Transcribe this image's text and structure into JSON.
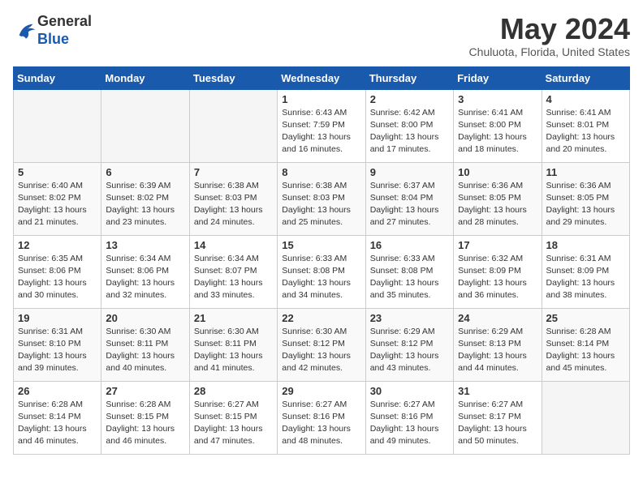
{
  "logo": {
    "general": "General",
    "blue": "Blue"
  },
  "title": {
    "month_year": "May 2024",
    "location": "Chuluota, Florida, United States"
  },
  "days_of_week": [
    "Sunday",
    "Monday",
    "Tuesday",
    "Wednesday",
    "Thursday",
    "Friday",
    "Saturday"
  ],
  "weeks": [
    [
      {
        "day": "",
        "info": ""
      },
      {
        "day": "",
        "info": ""
      },
      {
        "day": "",
        "info": ""
      },
      {
        "day": "1",
        "info": "Sunrise: 6:43 AM\nSunset: 7:59 PM\nDaylight: 13 hours\nand 16 minutes."
      },
      {
        "day": "2",
        "info": "Sunrise: 6:42 AM\nSunset: 8:00 PM\nDaylight: 13 hours\nand 17 minutes."
      },
      {
        "day": "3",
        "info": "Sunrise: 6:41 AM\nSunset: 8:00 PM\nDaylight: 13 hours\nand 18 minutes."
      },
      {
        "day": "4",
        "info": "Sunrise: 6:41 AM\nSunset: 8:01 PM\nDaylight: 13 hours\nand 20 minutes."
      }
    ],
    [
      {
        "day": "5",
        "info": "Sunrise: 6:40 AM\nSunset: 8:02 PM\nDaylight: 13 hours\nand 21 minutes."
      },
      {
        "day": "6",
        "info": "Sunrise: 6:39 AM\nSunset: 8:02 PM\nDaylight: 13 hours\nand 23 minutes."
      },
      {
        "day": "7",
        "info": "Sunrise: 6:38 AM\nSunset: 8:03 PM\nDaylight: 13 hours\nand 24 minutes."
      },
      {
        "day": "8",
        "info": "Sunrise: 6:38 AM\nSunset: 8:03 PM\nDaylight: 13 hours\nand 25 minutes."
      },
      {
        "day": "9",
        "info": "Sunrise: 6:37 AM\nSunset: 8:04 PM\nDaylight: 13 hours\nand 27 minutes."
      },
      {
        "day": "10",
        "info": "Sunrise: 6:36 AM\nSunset: 8:05 PM\nDaylight: 13 hours\nand 28 minutes."
      },
      {
        "day": "11",
        "info": "Sunrise: 6:36 AM\nSunset: 8:05 PM\nDaylight: 13 hours\nand 29 minutes."
      }
    ],
    [
      {
        "day": "12",
        "info": "Sunrise: 6:35 AM\nSunset: 8:06 PM\nDaylight: 13 hours\nand 30 minutes."
      },
      {
        "day": "13",
        "info": "Sunrise: 6:34 AM\nSunset: 8:06 PM\nDaylight: 13 hours\nand 32 minutes."
      },
      {
        "day": "14",
        "info": "Sunrise: 6:34 AM\nSunset: 8:07 PM\nDaylight: 13 hours\nand 33 minutes."
      },
      {
        "day": "15",
        "info": "Sunrise: 6:33 AM\nSunset: 8:08 PM\nDaylight: 13 hours\nand 34 minutes."
      },
      {
        "day": "16",
        "info": "Sunrise: 6:33 AM\nSunset: 8:08 PM\nDaylight: 13 hours\nand 35 minutes."
      },
      {
        "day": "17",
        "info": "Sunrise: 6:32 AM\nSunset: 8:09 PM\nDaylight: 13 hours\nand 36 minutes."
      },
      {
        "day": "18",
        "info": "Sunrise: 6:31 AM\nSunset: 8:09 PM\nDaylight: 13 hours\nand 38 minutes."
      }
    ],
    [
      {
        "day": "19",
        "info": "Sunrise: 6:31 AM\nSunset: 8:10 PM\nDaylight: 13 hours\nand 39 minutes."
      },
      {
        "day": "20",
        "info": "Sunrise: 6:30 AM\nSunset: 8:11 PM\nDaylight: 13 hours\nand 40 minutes."
      },
      {
        "day": "21",
        "info": "Sunrise: 6:30 AM\nSunset: 8:11 PM\nDaylight: 13 hours\nand 41 minutes."
      },
      {
        "day": "22",
        "info": "Sunrise: 6:30 AM\nSunset: 8:12 PM\nDaylight: 13 hours\nand 42 minutes."
      },
      {
        "day": "23",
        "info": "Sunrise: 6:29 AM\nSunset: 8:12 PM\nDaylight: 13 hours\nand 43 minutes."
      },
      {
        "day": "24",
        "info": "Sunrise: 6:29 AM\nSunset: 8:13 PM\nDaylight: 13 hours\nand 44 minutes."
      },
      {
        "day": "25",
        "info": "Sunrise: 6:28 AM\nSunset: 8:14 PM\nDaylight: 13 hours\nand 45 minutes."
      }
    ],
    [
      {
        "day": "26",
        "info": "Sunrise: 6:28 AM\nSunset: 8:14 PM\nDaylight: 13 hours\nand 46 minutes."
      },
      {
        "day": "27",
        "info": "Sunrise: 6:28 AM\nSunset: 8:15 PM\nDaylight: 13 hours\nand 46 minutes."
      },
      {
        "day": "28",
        "info": "Sunrise: 6:27 AM\nSunset: 8:15 PM\nDaylight: 13 hours\nand 47 minutes."
      },
      {
        "day": "29",
        "info": "Sunrise: 6:27 AM\nSunset: 8:16 PM\nDaylight: 13 hours\nand 48 minutes."
      },
      {
        "day": "30",
        "info": "Sunrise: 6:27 AM\nSunset: 8:16 PM\nDaylight: 13 hours\nand 49 minutes."
      },
      {
        "day": "31",
        "info": "Sunrise: 6:27 AM\nSunset: 8:17 PM\nDaylight: 13 hours\nand 50 minutes."
      },
      {
        "day": "",
        "info": ""
      }
    ]
  ]
}
